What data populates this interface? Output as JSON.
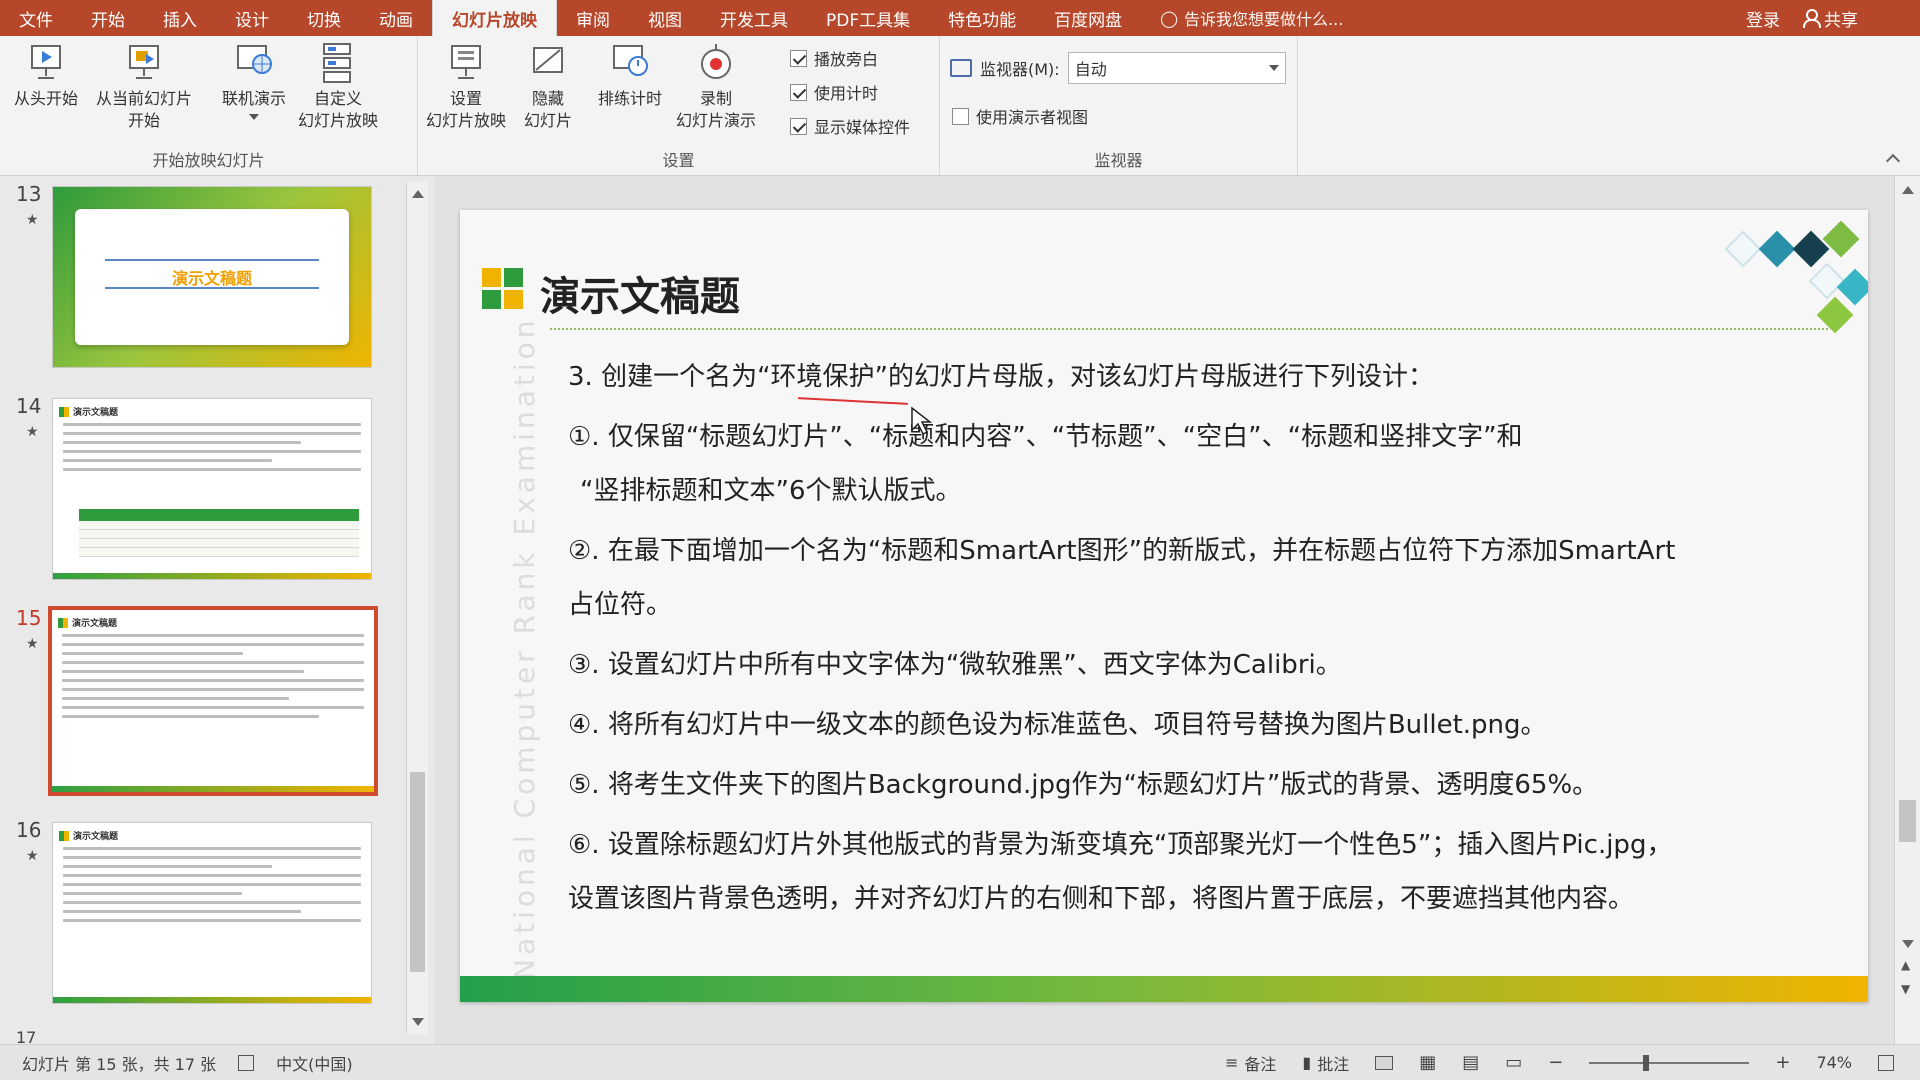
{
  "tabs": [
    "文件",
    "开始",
    "插入",
    "设计",
    "切换",
    "动画",
    "幻灯片放映",
    "审阅",
    "视图",
    "开发工具",
    "PDF工具集",
    "特色功能",
    "百度网盘"
  ],
  "active_tab": "幻灯片放映",
  "tell_me": "告诉我您想要做什么...",
  "login": "登录",
  "share": "共享",
  "ribbon": {
    "group1": {
      "label": "开始放映幻灯片",
      "from_start": "从头开始",
      "from_current": "从当前幻灯片\n开始",
      "online": "联机演示",
      "custom": "自定义\n幻灯片放映"
    },
    "group2": {
      "label": "设置",
      "setup": "设置\n幻灯片放映",
      "hide": "隐藏\n幻灯片",
      "rehearse": "排练计时",
      "record": "录制\n幻灯片演示",
      "play_narration": "播放旁白",
      "use_timings": "使用计时",
      "show_media": "显示媒体控件"
    },
    "group3": {
      "label": "监视器",
      "monitor_label": "监视器(M):",
      "monitor_value": "自动",
      "presenter_view": "使用演示者视图"
    }
  },
  "thumbnails": {
    "n13": "13",
    "n14": "14",
    "n15": "15",
    "n16": "16",
    "n17": "17",
    "t13_title": "演示文稿题",
    "t_head": "演示文稿题",
    "selected": "15"
  },
  "slide": {
    "title": "演示文稿题",
    "watermark": "National Computer Rank Examination",
    "lines": [
      "3. 创建一个名为“环境保护”的幻灯片母版，对该幻灯片母版进行下列设计：",
      "①. 仅保留“标题幻灯片”、“标题和内容”、“节标题”、“空白”、“标题和竖排文字”和",
      "“竖排标题和文本”6个默认版式。",
      "②. 在最下面增加一个名为“标题和SmartArt图形”的新版式，并在标题占位符下方添加SmartArt",
      "占位符。",
      "③. 设置幻灯片中所有中文字体为“微软雅黑”、西文字体为Calibri。",
      "④. 将所有幻灯片中一级文本的颜色设为标准蓝色、项目符号替换为图片Bullet.png。",
      "⑤. 将考生文件夹下的图片Background.jpg作为“标题幻灯片”版式的背景、透明度65%。",
      "⑥. 设置除标题幻灯片外其他版式的背景为渐变填充“顶部聚光灯一个性色5”；插入图片Pic.jpg，",
      "设置该图片背景色透明，并对齐幻灯片的右侧和下部，将图片置于底层，不要遮挡其他内容。"
    ]
  },
  "status": {
    "slide_info": "幻灯片 第 15 张，共 17 张",
    "language": "中文(中国)",
    "notes": "备注",
    "comments": "批注",
    "zoom": "74%"
  },
  "colors": {
    "tab_bar": "#b7472a",
    "accent_green": "#2e9b3c",
    "accent_yellow": "#f0b400"
  }
}
